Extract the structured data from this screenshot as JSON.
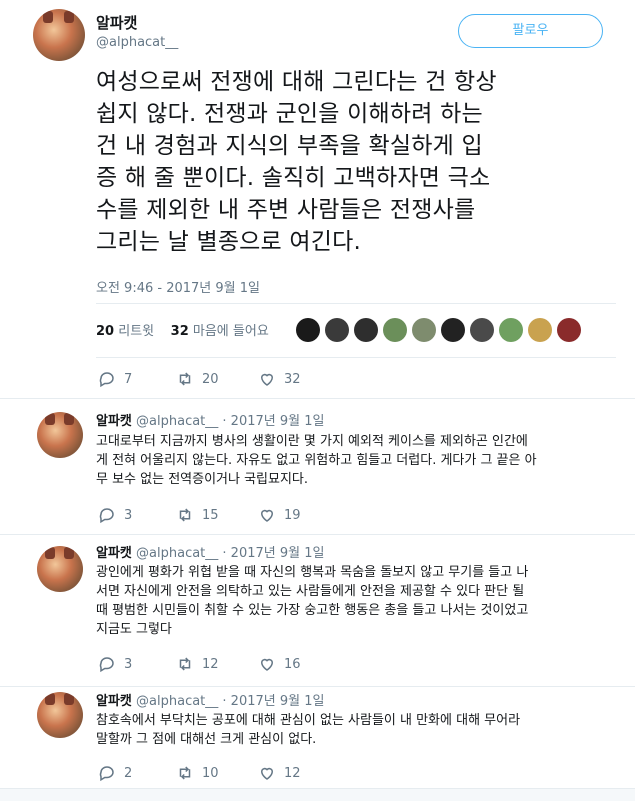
{
  "main_tweet": {
    "display_name": "알파캣",
    "handle": "@alphacat__",
    "follow_label": "팔로우",
    "text": "여성으로써 전쟁에 대해 그린다는 건 항상\n쉽지 않다. 전쟁과 군인을 이해하려 하는\n건 내 경험과 지식의 부족을 확실하게 입\n증 해 줄 뿐이다. 솔직히 고백하자면 극소\n수를 제외한 내 주변 사람들은 전쟁사를\n그리는 날 별종으로 여긴다.",
    "timestamp": "오전 9:46 - 2017년 9월 1일",
    "retweets_count": "20",
    "retweets_label": "리트윗",
    "likes_count": "32",
    "likes_label": "마음에 들어요",
    "liker_colors": [
      "#1a1a1a",
      "#3a3a3a",
      "#2e2e2e",
      "#6b8f5a",
      "#7e8c6e",
      "#222222",
      "#4a4a4a",
      "#6fa060",
      "#c9a24f",
      "#8a2b2b"
    ],
    "reply_count": "7",
    "retweet_count": "20",
    "like_count": "32"
  },
  "replies": [
    {
      "display_name": "알파캣",
      "meta": "@alphacat__ · 2017년 9월 1일",
      "text": "고대로부터 지금까지 병사의 생활이란 몇 가지 예외적 케이스를 제외하곤  인간에\n게 전혀 어울리지 않는다. 자유도 없고 위험하고 힘들고 더럽다. 게다가 그 끝은 아\n무 보수 없는 전역증이거나 국립묘지다.",
      "reply_count": "3",
      "retweet_count": "15",
      "like_count": "19"
    },
    {
      "display_name": "알파캣",
      "meta": "@alphacat__ · 2017년 9월 1일",
      "text": "광인에게 평화가 위협 받을 때 자신의 행복과 목숨을 돌보지 않고 무기를 들고 나\n서면 자신에게 안전을 의탁하고 있는 사람들에게 안전을 제공할 수 있다 판단 될\n때 평범한 시민들이 취할 수 있는 가장 숭고한 행동은 총을 들고 나서는 것이었고\n지금도 그렇다",
      "reply_count": "3",
      "retweet_count": "12",
      "like_count": "16"
    },
    {
      "display_name": "알파캣",
      "meta": "@alphacat__ · 2017년 9월 1일",
      "text": "참호속에서 부닥치는 공포에 대해 관심이 없는 사람들이 내 만화에 대해 무어라\n말할까 그 점에 대해선 크게 관심이 없다.",
      "reply_count": "2",
      "retweet_count": "10",
      "like_count": "12"
    }
  ]
}
